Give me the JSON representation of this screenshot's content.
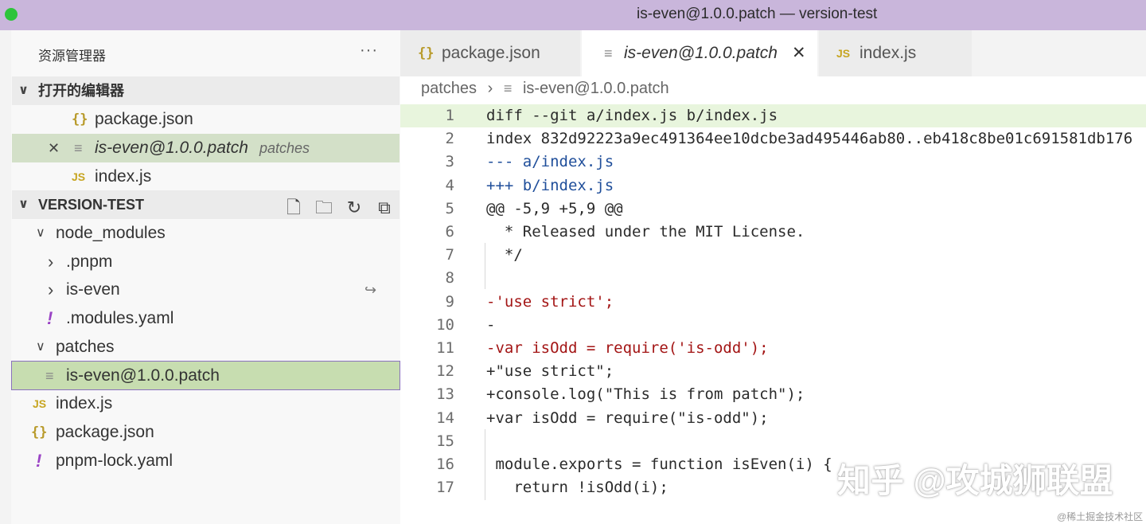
{
  "window": {
    "title": "is-even@1.0.0.patch — version-test"
  },
  "explorer": {
    "header": "资源管理器",
    "more": "···",
    "open_editors_label": "打开的编辑器",
    "open_editors": [
      {
        "icon": "{}",
        "name": "package.json",
        "detail": ""
      },
      {
        "icon": "≡",
        "name": "is-even@1.0.0.patch",
        "detail": "patches"
      },
      {
        "icon": "JS",
        "name": "index.js",
        "detail": ""
      }
    ],
    "project_label": "VERSION-TEST",
    "tree": [
      {
        "chev": "∨",
        "icon": "",
        "name": "node_modules"
      },
      {
        "chev": "›",
        "icon": "",
        "name": ".pnpm"
      },
      {
        "chev": "›",
        "icon": "",
        "name": "is-even",
        "badge": "↪"
      },
      {
        "chev": "",
        "icon": "!",
        "name": ".modules.yaml"
      },
      {
        "chev": "∨",
        "icon": "",
        "name": "patches"
      },
      {
        "chev": "",
        "icon": "≡",
        "name": "is-even@1.0.0.patch"
      },
      {
        "chev": "",
        "icon": "JS",
        "name": "index.js"
      },
      {
        "chev": "",
        "icon": "{}",
        "name": "package.json"
      },
      {
        "chev": "",
        "icon": "!",
        "name": "pnpm-lock.yaml"
      }
    ]
  },
  "tabs": [
    {
      "icon": "{}",
      "label": "package.json"
    },
    {
      "icon": "≡",
      "label": "is-even@1.0.0.patch",
      "close": "✕"
    },
    {
      "icon": "JS",
      "label": "index.js"
    }
  ],
  "breadcrumb": {
    "folder": "patches",
    "sep": "›",
    "icon": "≡",
    "file": "is-even@1.0.0.patch"
  },
  "editor": {
    "lines": [
      {
        "n": "1",
        "text": "diff --git a/index.js b/index.js"
      },
      {
        "n": "2",
        "text": "index 832d92223a9ec491364ee10dcbe3ad495446ab80..eb418c8be01c691581db176"
      },
      {
        "n": "3",
        "text": "--- a/index.js"
      },
      {
        "n": "4",
        "text": "+++ b/index.js"
      },
      {
        "n": "5",
        "text": "@@ -5,9 +5,9 @@"
      },
      {
        "n": "6",
        "text": "  * Released under the MIT License."
      },
      {
        "n": "7",
        "text": "  */"
      },
      {
        "n": "8",
        "text": ""
      },
      {
        "n": "9",
        "text": "-'use strict';"
      },
      {
        "n": "10",
        "text": "-"
      },
      {
        "n": "11",
        "text": "-var isOdd = require('is-odd');"
      },
      {
        "n": "12",
        "text": "+\"use strict\";"
      },
      {
        "n": "13",
        "text": "+console.log(\"This is from patch\");"
      },
      {
        "n": "14",
        "text": "+var isOdd = require(\"is-odd\");"
      },
      {
        "n": "15",
        "text": ""
      },
      {
        "n": "16",
        "text": " module.exports = function isEven(i) {"
      },
      {
        "n": "17",
        "text": "   return !isOdd(i);"
      }
    ]
  },
  "watermark": {
    "main": "知乎 @攻城狮联盟",
    "small": "@稀土掘金技术社区"
  },
  "colors": {
    "titlebar": "#c9b6db",
    "selection": "#d3e0c8",
    "line_highlight": "#e8f5dd",
    "keyword_blue": "#1f4e9a",
    "string_red": "#a31515"
  }
}
